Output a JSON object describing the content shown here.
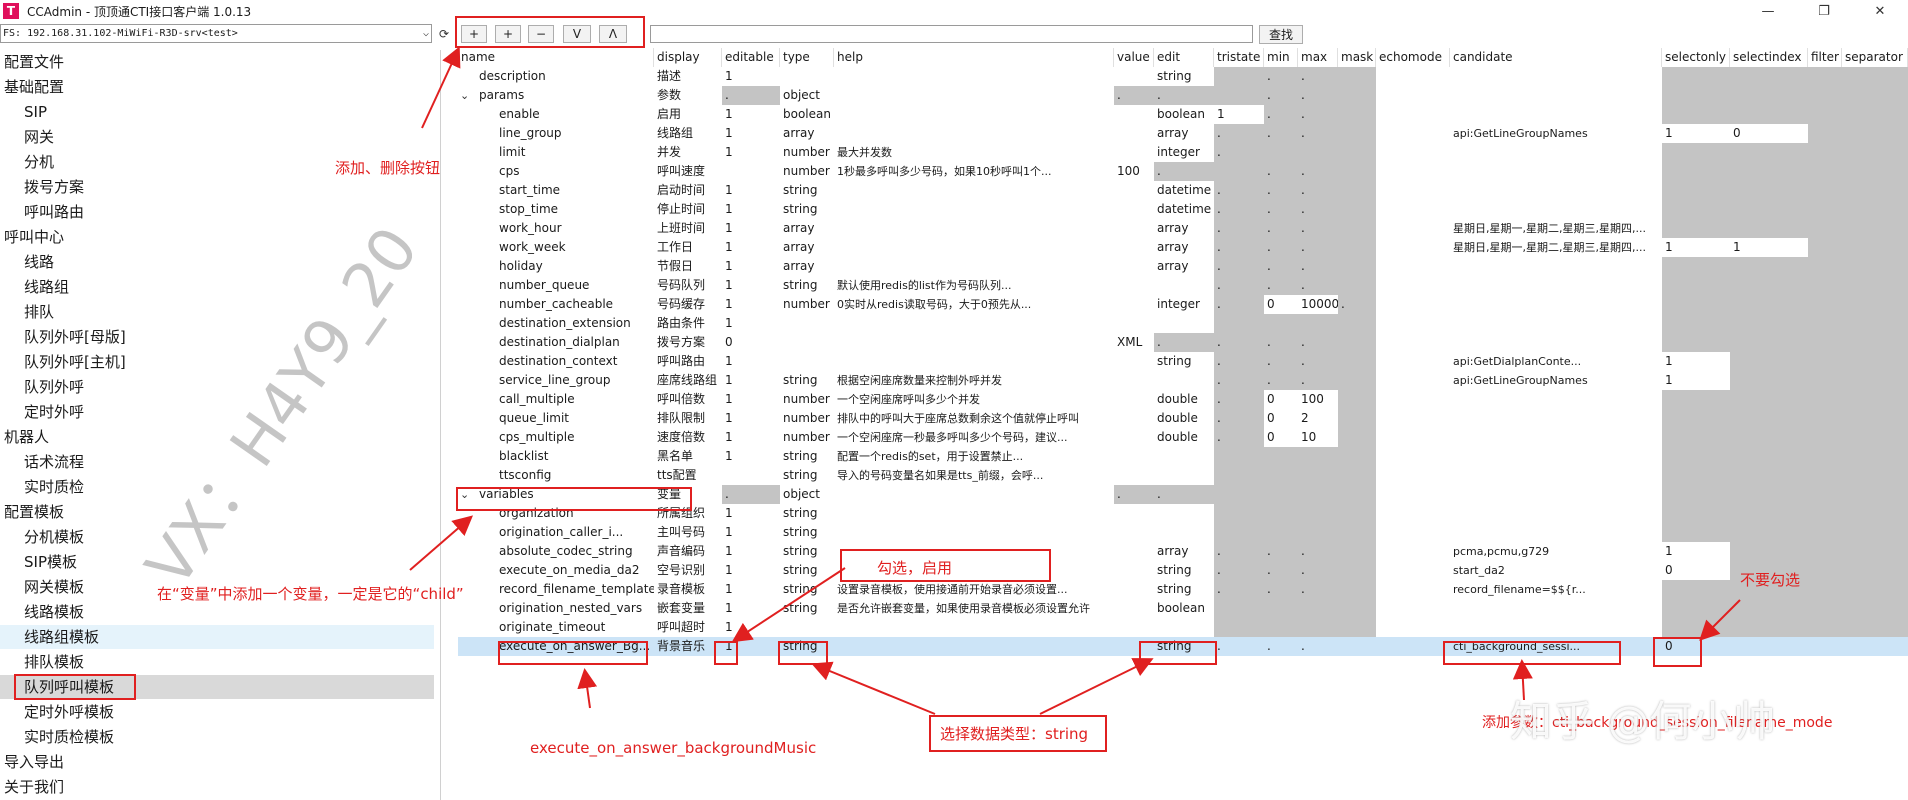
{
  "window": {
    "title": "CCAdmin - 顶顶通CTI接口客户端 1.0.13",
    "logo_letter": "T",
    "min_label": "—",
    "max_label": "❐",
    "close_label": "✕"
  },
  "server": {
    "value": "FS: 192.168.31.102-MiWiFi-R3D-srv<test>",
    "chevron": "⌵",
    "refresh_icon": "⟳"
  },
  "toolbar": {
    "add_label": "+",
    "add_child_label": "+",
    "delete_label": "−",
    "down_label": "V",
    "up_label": "Λ",
    "search_value": "",
    "search_label": "查找"
  },
  "sidebar": {
    "items": [
      {
        "label": "配置文件",
        "level": 0
      },
      {
        "label": "基础配置",
        "level": 0
      },
      {
        "label": "SIP",
        "level": 1
      },
      {
        "label": "网关",
        "level": 1
      },
      {
        "label": "分机",
        "level": 1
      },
      {
        "label": "拨号方案",
        "level": 1
      },
      {
        "label": "呼叫路由",
        "level": 1
      },
      {
        "label": "呼叫中心",
        "level": 0
      },
      {
        "label": "线路",
        "level": 1
      },
      {
        "label": "线路组",
        "level": 1
      },
      {
        "label": "排队",
        "level": 1
      },
      {
        "label": "队列外呼[母版]",
        "level": 1
      },
      {
        "label": "队列外呼[主机]",
        "level": 1
      },
      {
        "label": "队列外呼",
        "level": 1
      },
      {
        "label": "定时外呼",
        "level": 1
      },
      {
        "label": "机器人",
        "level": 0
      },
      {
        "label": "话术流程",
        "level": 1
      },
      {
        "label": "实时质检",
        "level": 1
      },
      {
        "label": "配置模板",
        "level": 0
      },
      {
        "label": "分机模板",
        "level": 1
      },
      {
        "label": "SIP模板",
        "level": 1
      },
      {
        "label": "网关模板",
        "level": 1
      },
      {
        "label": "线路模板",
        "level": 1
      },
      {
        "label": "线路组模板",
        "level": 1,
        "highlight": "light"
      },
      {
        "label": "排队模板",
        "level": 1
      },
      {
        "label": "队列呼叫模板",
        "level": 1,
        "highlight": "gray"
      },
      {
        "label": "定时外呼模板",
        "level": 1
      },
      {
        "label": "实时质检模板",
        "level": 1
      },
      {
        "label": "导入导出",
        "level": 0
      },
      {
        "label": "关于我们",
        "level": 0
      }
    ]
  },
  "table": {
    "columns": [
      "name",
      "display",
      "editable",
      "type",
      "help",
      "value",
      "edit",
      "tristate",
      "min",
      "max",
      "mask",
      "echomode",
      "candidate",
      "selectonly",
      "selectindex",
      "filter",
      "separator"
    ],
    "rows": [
      {
        "name": "description",
        "display": "描述",
        "editable": "1",
        "type": "",
        "help": "",
        "value": "",
        "edit": "string",
        "tristate": "",
        "min": ".",
        "max": ".",
        "mask": "",
        "echomode": "",
        "candidate": "",
        "selectonly": "",
        "selectindex": "",
        "filter": "",
        "separator": "",
        "indent": 1
      },
      {
        "name": "params",
        "display": "参数",
        "editable": ".",
        "type": "object",
        "help": "",
        "value": ".",
        "edit": ".",
        "tristate": "",
        "min": ".",
        "max": ".",
        "mask": "",
        "echomode": "",
        "candidate": "",
        "selectonly": "",
        "selectindex": "",
        "filter": "",
        "separator": "",
        "indent": 1,
        "expander": "⌄"
      },
      {
        "name": "enable",
        "display": "启用",
        "editable": "1",
        "type": "boolean",
        "help": "",
        "value": "",
        "edit": "boolean",
        "tristate": "1",
        "min": ".",
        "max": ".",
        "mask": "",
        "echomode": "",
        "candidate": "",
        "selectonly": "",
        "selectindex": "",
        "filter": "",
        "separator": "",
        "indent": 2
      },
      {
        "name": "line_group",
        "display": "线路组",
        "editable": "1",
        "type": "array",
        "help": "",
        "value": "",
        "edit": "array",
        "tristate": ".",
        "min": ".",
        "max": ".",
        "mask": "",
        "echomode": "",
        "candidate": "api:GetLineGroupNames",
        "selectonly": "1",
        "selectindex": "0",
        "filter": "",
        "separator": "",
        "indent": 2
      },
      {
        "name": "limit",
        "display": "并发",
        "editable": "1",
        "type": "number",
        "help": "最大并发数",
        "value": "",
        "edit": "integer",
        "tristate": ".",
        "min": "",
        "max": "",
        "mask": "",
        "echomode": "",
        "candidate": "",
        "selectonly": "",
        "selectindex": "",
        "filter": "",
        "separator": "",
        "indent": 2
      },
      {
        "name": "cps",
        "display": "呼叫速度",
        "editable": "",
        "type": "number",
        "help": "1秒最多呼叫多少号码，如果10秒呼叫1个...",
        "value": "100",
        "edit": ".",
        "tristate": "",
        "min": ".",
        "max": ".",
        "mask": "",
        "echomode": "",
        "candidate": "",
        "selectonly": "",
        "selectindex": "",
        "filter": "",
        "separator": "",
        "indent": 2
      },
      {
        "name": "start_time",
        "display": "启动时间",
        "editable": "1",
        "type": "string",
        "help": "",
        "value": "",
        "edit": "datetime",
        "tristate": ".",
        "min": ".",
        "max": ".",
        "mask": "",
        "echomode": "",
        "candidate": "",
        "selectonly": "",
        "selectindex": "",
        "filter": "",
        "separator": "",
        "indent": 2
      },
      {
        "name": "stop_time",
        "display": "停止时间",
        "editable": "1",
        "type": "string",
        "help": "",
        "value": "",
        "edit": "datetime",
        "tristate": ".",
        "min": ".",
        "max": ".",
        "mask": "",
        "echomode": "",
        "candidate": "",
        "selectonly": "",
        "selectindex": "",
        "filter": "",
        "separator": "",
        "indent": 2
      },
      {
        "name": "work_hour",
        "display": "上班时间",
        "editable": "1",
        "type": "array",
        "help": "",
        "value": "",
        "edit": "array",
        "tristate": ".",
        "min": ".",
        "max": ".",
        "mask": "",
        "echomode": "",
        "candidate": "星期日,星期一,星期二,星期三,星期四,...",
        "selectonly": "",
        "selectindex": "",
        "filter": "",
        "separator": "",
        "indent": 2
      },
      {
        "name": "work_week",
        "display": "工作日",
        "editable": "1",
        "type": "array",
        "help": "",
        "value": "",
        "edit": "array",
        "tristate": ".",
        "min": ".",
        "max": ".",
        "mask": "",
        "echomode": "",
        "candidate": "星期日,星期一,星期二,星期三,星期四,...",
        "selectonly": "1",
        "selectindex": "1",
        "filter": "",
        "separator": "",
        "indent": 2
      },
      {
        "name": "holiday",
        "display": "节假日",
        "editable": "1",
        "type": "array",
        "help": "",
        "value": "",
        "edit": "array",
        "tristate": ".",
        "min": ".",
        "max": ".",
        "mask": "",
        "echomode": "",
        "candidate": "",
        "selectonly": "",
        "selectindex": "",
        "filter": "",
        "separator": "",
        "indent": 2
      },
      {
        "name": "number_queue",
        "display": "号码队列",
        "editable": "1",
        "type": "string",
        "help": "默认使用redis的list作为号码队列...",
        "value": "",
        "edit": "",
        "tristate": ".",
        "min": ".",
        "max": ".",
        "mask": "",
        "echomode": "",
        "candidate": "",
        "selectonly": "",
        "selectindex": "",
        "filter": "",
        "separator": "",
        "indent": 2
      },
      {
        "name": "number_cacheable",
        "display": "号码缓存",
        "editable": "1",
        "type": "number",
        "help": "0实时从redis读取号码，大于0预先从...",
        "value": "",
        "edit": "integer",
        "tristate": ".",
        "min": "0",
        "max": "10000",
        "mask": ".",
        "echomode": "",
        "candidate": "",
        "selectonly": "",
        "selectindex": "",
        "filter": "",
        "separator": "",
        "indent": 2
      },
      {
        "name": "destination_extension",
        "display": "路由条件",
        "editable": "1",
        "type": "",
        "help": "",
        "value": "",
        "edit": "",
        "tristate": "",
        "min": "",
        "max": "",
        "mask": "",
        "echomode": "",
        "candidate": "",
        "selectonly": "",
        "selectindex": "",
        "filter": "",
        "separator": "",
        "indent": 2
      },
      {
        "name": "destination_dialplan",
        "display": "拨号方案",
        "editable": "0",
        "type": "",
        "help": "",
        "value": "XML",
        "edit": ".",
        "tristate": ".",
        "min": ".",
        "max": ".",
        "mask": "",
        "echomode": "",
        "candidate": "",
        "selectonly": "",
        "selectindex": "",
        "filter": "",
        "separator": "",
        "indent": 2
      },
      {
        "name": "destination_context",
        "display": "呼叫路由",
        "editable": "1",
        "type": "",
        "help": "",
        "value": "",
        "edit": "string",
        "tristate": ".",
        "min": ".",
        "max": ".",
        "mask": "",
        "echomode": "",
        "candidate": "api:GetDialplanConte...",
        "selectonly": "1",
        "selectindex": "",
        "filter": "",
        "separator": "",
        "indent": 2
      },
      {
        "name": "service_line_group",
        "display": "座席线路组",
        "editable": "1",
        "type": "string",
        "help": "根据空闲座席数量来控制外呼并发",
        "value": "",
        "edit": "",
        "tristate": ".",
        "min": ".",
        "max": ".",
        "mask": "",
        "echomode": "",
        "candidate": "api:GetLineGroupNames",
        "selectonly": "1",
        "selectindex": "",
        "filter": "",
        "separator": "",
        "indent": 2
      },
      {
        "name": "call_multiple",
        "display": "呼叫倍数",
        "editable": "1",
        "type": "number",
        "help": "一个空闲座席呼叫多少个并发",
        "value": "",
        "edit": "double",
        "tristate": ".",
        "min": "0",
        "max": "100",
        "mask": "",
        "echomode": "",
        "candidate": "",
        "selectonly": "",
        "selectindex": "",
        "filter": "",
        "separator": "",
        "indent": 2
      },
      {
        "name": "queue_limit",
        "display": "排队限制",
        "editable": "1",
        "type": "number",
        "help": "排队中的呼叫大于座席总数剩余这个值就停止呼叫",
        "value": "",
        "edit": "double",
        "tristate": ".",
        "min": "0",
        "max": "2",
        "mask": "",
        "echomode": "",
        "candidate": "",
        "selectonly": "",
        "selectindex": "",
        "filter": "",
        "separator": "",
        "indent": 2
      },
      {
        "name": "cps_multiple",
        "display": "速度倍数",
        "editable": "1",
        "type": "number",
        "help": "一个空闲座席一秒最多呼叫多少个号码，建议...",
        "value": "",
        "edit": "double",
        "tristate": ".",
        "min": "0",
        "max": "10",
        "mask": "",
        "echomode": "",
        "candidate": "",
        "selectonly": "",
        "selectindex": "",
        "filter": "",
        "separator": "",
        "indent": 2
      },
      {
        "name": "blacklist",
        "display": "黑名单",
        "editable": "1",
        "type": "string",
        "help": "配置一个redis的set，用于设置禁止...",
        "value": "",
        "edit": "",
        "tristate": "",
        "min": "",
        "max": "",
        "mask": "",
        "echomode": "",
        "candidate": "",
        "selectonly": "",
        "selectindex": "",
        "filter": "",
        "separator": "",
        "indent": 2
      },
      {
        "name": "ttsconfig",
        "display": "tts配置",
        "editable": "",
        "type": "string",
        "help": "导入的号码变量名如果是tts_前缀，会呼...",
        "value": "",
        "edit": "",
        "tristate": "",
        "min": "",
        "max": "",
        "mask": "",
        "echomode": "",
        "candidate": "",
        "selectonly": "",
        "selectindex": "",
        "filter": "",
        "separator": "",
        "indent": 2
      },
      {
        "name": "variables",
        "display": "变量",
        "editable": ".",
        "type": "object",
        "help": "",
        "value": ".",
        "edit": ".",
        "tristate": "",
        "min": "",
        "max": "",
        "mask": "",
        "echomode": "",
        "candidate": "",
        "selectonly": "",
        "selectindex": "",
        "filter": "",
        "separator": "",
        "indent": 1,
        "expander": "⌄"
      },
      {
        "name": "organization",
        "display": "所属组织",
        "editable": "1",
        "type": "string",
        "help": "",
        "value": "",
        "edit": "",
        "tristate": "",
        "min": "",
        "max": "",
        "mask": "",
        "echomode": "",
        "candidate": "",
        "selectonly": "",
        "selectindex": "",
        "filter": "",
        "separator": "",
        "indent": 2
      },
      {
        "name": "origination_caller_i...",
        "display": "主叫号码",
        "editable": "1",
        "type": "string",
        "help": "",
        "value": "",
        "edit": "",
        "tristate": "",
        "min": "",
        "max": "",
        "mask": "",
        "echomode": "",
        "candidate": "",
        "selectonly": "",
        "selectindex": "",
        "filter": "",
        "separator": "",
        "indent": 2
      },
      {
        "name": "absolute_codec_string",
        "display": "声音编码",
        "editable": "1",
        "type": "string",
        "help": "",
        "value": "",
        "edit": "array",
        "tristate": ".",
        "min": ".",
        "max": ".",
        "mask": "",
        "echomode": "",
        "candidate": "pcma,pcmu,g729",
        "selectonly": "1",
        "selectindex": "",
        "filter": "",
        "separator": "",
        "indent": 2
      },
      {
        "name": "execute_on_media_da2",
        "display": "空号识别",
        "editable": "1",
        "type": "string",
        "help": "",
        "value": "",
        "edit": "string",
        "tristate": ".",
        "min": ".",
        "max": ".",
        "mask": "",
        "echomode": "",
        "candidate": "start_da2",
        "selectonly": "0",
        "selectindex": "",
        "filter": "",
        "separator": "",
        "indent": 2
      },
      {
        "name": "record_filename_template",
        "display": "录音模板",
        "editable": "1",
        "type": "string",
        "help": "设置录音模板，使用接通前开始录音必须设置...",
        "value": "",
        "edit": "string",
        "tristate": ".",
        "min": ".",
        "max": ".",
        "mask": "",
        "echomode": "",
        "candidate": "record_filename=$${r...",
        "selectonly": "",
        "selectindex": "",
        "filter": "",
        "separator": "",
        "indent": 2
      },
      {
        "name": "origination_nested_vars",
        "display": "嵌套变量",
        "editable": "1",
        "type": "string",
        "help": "是否允许嵌套变量，如果使用录音模板必须设置允许",
        "value": "",
        "edit": "boolean",
        "tristate": "",
        "min": "",
        "max": "",
        "mask": "",
        "echomode": "",
        "candidate": "",
        "selectonly": "",
        "selectindex": "",
        "filter": "",
        "separator": "",
        "indent": 2
      },
      {
        "name": "originate_timeout",
        "display": "呼叫超时",
        "editable": "1",
        "type": "",
        "help": "",
        "value": "",
        "edit": "",
        "tristate": "",
        "min": "",
        "max": "",
        "mask": "",
        "echomode": "",
        "candidate": "",
        "selectonly": "",
        "selectindex": "",
        "filter": "",
        "separator": "",
        "indent": 2
      },
      {
        "name": "execute_on_answer_Bg...",
        "display": "背景音乐",
        "editable": "1",
        "type": "string",
        "help": "",
        "value": "",
        "edit": "string",
        "tristate": ".",
        "min": ".",
        "max": ".",
        "mask": "",
        "echomode": "",
        "candidate": "cti_background_sessi...",
        "selectonly": "0",
        "selectindex": "",
        "filter": "",
        "separator": "",
        "indent": 2,
        "selected": true
      }
    ]
  },
  "annotations": {
    "add_delete": "添加、删除按钮",
    "add_variable": "在“变量”中添加一个变量，一定是它的“child”",
    "check_enable": "勾选，启用",
    "no_check": "不要勾选",
    "var_name": "execute_on_answer_backgroundMusic",
    "choose_type": "选择数据类型：string",
    "add_value": "添加参数：cti_background_session_filename_mode",
    "watermark": "VX：H4Y9_20",
    "zhihu": "知乎 @何小帅"
  },
  "colors": {
    "annotation_red": "#e02020",
    "selected_row": "#cce4f7",
    "gray_cell": "#c4c4c4"
  }
}
